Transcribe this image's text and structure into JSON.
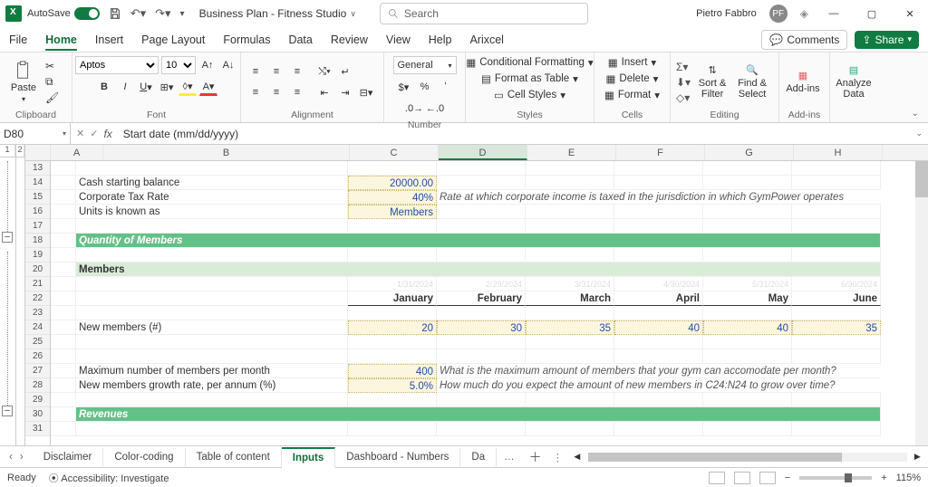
{
  "titlebar": {
    "autosave_label": "AutoSave",
    "doc_title": "Business Plan - Fitness Studio",
    "search_placeholder": "Search",
    "user_name": "Pietro Fabbro",
    "user_initials": "PF"
  },
  "menutabs": {
    "items": [
      "File",
      "Home",
      "Insert",
      "Page Layout",
      "Formulas",
      "Data",
      "Review",
      "View",
      "Help",
      "Arixcel"
    ],
    "active": "Home",
    "comments_label": "Comments",
    "share_label": "Share"
  },
  "ribbon": {
    "clipboard": {
      "paste": "Paste",
      "label": "Clipboard"
    },
    "font": {
      "name": "Aptos",
      "size": "10",
      "label": "Font"
    },
    "alignment": {
      "label": "Alignment"
    },
    "number": {
      "format": "General",
      "label": "Number"
    },
    "styles": {
      "cond": "Conditional Formatting",
      "table": "Format as Table",
      "cell": "Cell Styles",
      "label": "Styles"
    },
    "cells": {
      "insert": "Insert",
      "delete": "Delete",
      "format": "Format",
      "label": "Cells"
    },
    "editing": {
      "sort": "Sort & Filter",
      "find": "Find & Select",
      "label": "Editing"
    },
    "addins": {
      "btn": "Add-ins",
      "label": "Add-ins"
    },
    "analyze": {
      "btn": "Analyze Data"
    }
  },
  "formula_bar": {
    "cell_ref": "D80",
    "formula": "Start date (mm/dd/yyyy)"
  },
  "columns": [
    "A",
    "B",
    "C",
    "D",
    "E",
    "F",
    "G",
    "H"
  ],
  "row_numbers": [
    "13",
    "14",
    "15",
    "16",
    "17",
    "18",
    "19",
    "20",
    "21",
    "22",
    "23",
    "24",
    "25",
    "26",
    "27",
    "28",
    "29",
    "30",
    "31"
  ],
  "sheet": {
    "r14": {
      "b": "Cash starting balance",
      "c": "20000.00"
    },
    "r15": {
      "b": "Corporate Tax Rate",
      "c": "40%",
      "note": "Rate at which corporate income is taxed in the jurisdiction in which GymPower operates"
    },
    "r16": {
      "b": "Units is known as",
      "c": "Members"
    },
    "r18": {
      "b": "Quantity of Members"
    },
    "r20": {
      "b": "Members"
    },
    "r21": {
      "dates_faint": [
        "1/31/2024",
        "2/29/2024",
        "3/31/2024",
        "4/30/2024",
        "5/31/2024",
        "6/30/2024"
      ]
    },
    "r22": {
      "months": [
        "January",
        "February",
        "March",
        "April",
        "May",
        "June"
      ]
    },
    "r24": {
      "b": "New members (#)",
      "vals": [
        "20",
        "30",
        "35",
        "40",
        "40",
        "35"
      ]
    },
    "r27": {
      "b": "Maximum number of members per month",
      "c": "400",
      "note": "What is the maximum amount of members that your gym can accomodate per month?"
    },
    "r28": {
      "b": "New members growth rate, per annum (%)",
      "c": "5.0%",
      "note": "How much do you expect the amount of new members in C24:N24 to grow over time?"
    },
    "r30": {
      "b": "Revenues"
    }
  },
  "sheet_tabs": {
    "items": [
      "Disclaimer",
      "Color-coding",
      "Table of content",
      "Inputs",
      "Dashboard - Numbers",
      "Da"
    ],
    "active": "Inputs"
  },
  "statusbar": {
    "ready": "Ready",
    "accessibility": "Accessibility: Investigate",
    "zoom": "115%"
  }
}
